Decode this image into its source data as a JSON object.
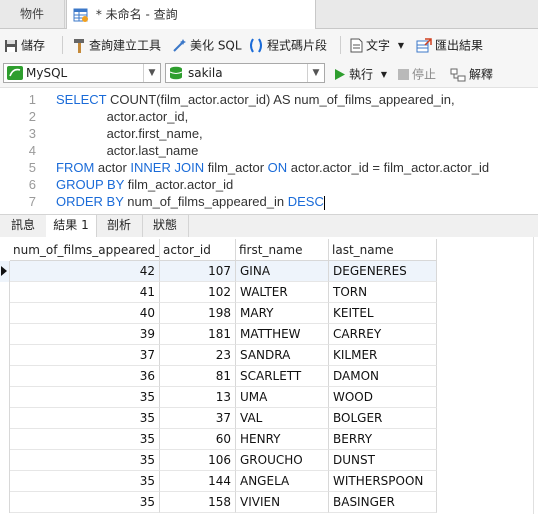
{
  "tabs": {
    "objects_label": "物件",
    "query_label": "* 未命名 - 查詢"
  },
  "toolbar": {
    "save": "儲存",
    "query_builder": "查詢建立工具",
    "beautify_sql": "美化 SQL",
    "code_snippets": "程式碼片段",
    "text": "文字",
    "export_results": "匯出結果"
  },
  "connection": {
    "server": "MySQL",
    "database": "sakila",
    "run": "執行",
    "stop": "停止",
    "explain": "解釋"
  },
  "editor": {
    "lines": [
      {
        "n": "1",
        "parts": [
          {
            "t": "SELECT",
            "k": true
          },
          {
            "t": " COUNT(film_actor.actor_id) AS num_of_films_appeared_in,",
            "k": false
          }
        ]
      },
      {
        "n": "2",
        "parts": [
          {
            "t": "              actor.actor_id,",
            "k": false
          }
        ]
      },
      {
        "n": "3",
        "parts": [
          {
            "t": "              actor.first_name,",
            "k": false
          }
        ]
      },
      {
        "n": "4",
        "parts": [
          {
            "t": "              actor.last_name",
            "k": false
          }
        ]
      },
      {
        "n": "5",
        "parts": [
          {
            "t": "FROM",
            "k": true
          },
          {
            "t": " actor ",
            "k": false
          },
          {
            "t": "INNER JOIN",
            "k": true
          },
          {
            "t": " film_actor ",
            "k": false
          },
          {
            "t": "ON",
            "k": true
          },
          {
            "t": " actor.actor_id = film_actor.actor_id",
            "k": false
          }
        ]
      },
      {
        "n": "6",
        "parts": [
          {
            "t": "GROUP BY",
            "k": true
          },
          {
            "t": " film_actor.actor_id",
            "k": false
          }
        ]
      },
      {
        "n": "7",
        "parts": [
          {
            "t": "ORDER BY",
            "k": true
          },
          {
            "t": " num_of_films_appeared_in ",
            "k": false
          },
          {
            "t": "DESC",
            "k": true
          }
        ]
      }
    ]
  },
  "result_tabs": [
    "訊息",
    "結果 1",
    "剖析",
    "狀態"
  ],
  "grid": {
    "columns": [
      "num_of_films_appeared_in",
      "actor_id",
      "first_name",
      "last_name"
    ],
    "rows": [
      [
        "42",
        "107",
        "GINA",
        "DEGENERES"
      ],
      [
        "41",
        "102",
        "WALTER",
        "TORN"
      ],
      [
        "40",
        "198",
        "MARY",
        "KEITEL"
      ],
      [
        "39",
        "181",
        "MATTHEW",
        "CARREY"
      ],
      [
        "37",
        "23",
        "SANDRA",
        "KILMER"
      ],
      [
        "36",
        "81",
        "SCARLETT",
        "DAMON"
      ],
      [
        "35",
        "13",
        "UMA",
        "WOOD"
      ],
      [
        "35",
        "37",
        "VAL",
        "BOLGER"
      ],
      [
        "35",
        "60",
        "HENRY",
        "BERRY"
      ],
      [
        "35",
        "106",
        "GROUCHO",
        "DUNST"
      ],
      [
        "35",
        "144",
        "ANGELA",
        "WITHERSPOON"
      ],
      [
        "35",
        "158",
        "VIVIEN",
        "BASINGER"
      ]
    ]
  },
  "colors": {
    "keyword": "#1a6bd8",
    "run_green": "#2e9e2e",
    "selected_row": "#eef4fb"
  }
}
